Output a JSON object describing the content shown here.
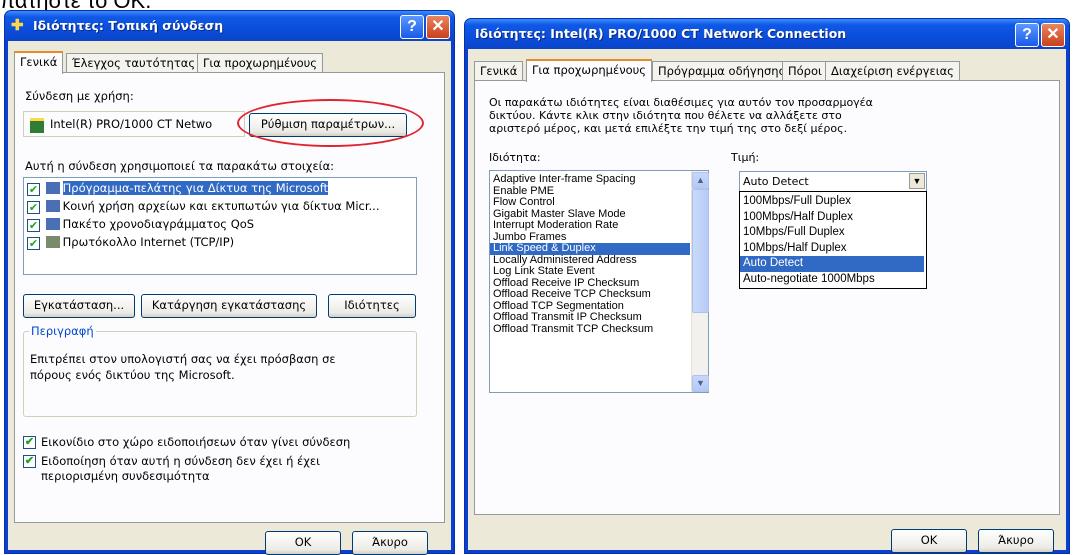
{
  "caption": "πατήστε το ΟΚ.",
  "win1": {
    "title": "Ιδιότητες: Τοπική σύνδεση",
    "tabs": [
      "Γενικά",
      "Έλεγχος ταυτότητας",
      "Για προχωρημένους"
    ],
    "connect_using_label": "Σύνδεση με χρήση:",
    "adapter_name": "Intel(R) PRO/1000 CT Netwo",
    "configure_button": "Ρύθμιση παραμέτρων...",
    "items_label": "Αυτή η σύνδεση χρησιμοποιεί τα παρακάτω στοιχεία:",
    "items": [
      "Πρόγραμμα-πελάτης για Δίκτυα της Microsoft",
      "Κοινή χρήση αρχείων και εκτυπωτών για δίκτυα Micr...",
      "Πακέτο χρονοδιαγράμματος QoS",
      "Πρωτόκολλο Internet (TCP/IP)"
    ],
    "install_button": "Εγκατάσταση...",
    "uninstall_button": "Κατάργηση εγκατάστασης",
    "properties_button": "Ιδιότητες",
    "description_title": "Περιγραφή",
    "description_text_1": "Επιτρέπει στον υπολογιστή σας να έχει πρόσβαση σε",
    "description_text_2": "πόρους ενός δικτύου της Microsoft.",
    "check_notify_icon": "Εικονίδιο στο χώρο ειδοποιήσεων όταν γίνει σύνδεση",
    "check_notify_limited_1": "Ειδοποίηση όταν αυτή η σύνδεση δεν έχει ή έχει",
    "check_notify_limited_2": "περιορισμένη συνδεσιμότητα",
    "ok_button": "OK",
    "cancel_button": "Άκυρο"
  },
  "win2": {
    "title": "Ιδιότητες: Intel(R) PRO/1000 CT Network Connection",
    "tabs": [
      "Γενικά",
      "Για προχωρημένους",
      "Πρόγραμμα οδήγησης",
      "Πόροι",
      "Διαχείριση ενέργειας"
    ],
    "intro_1": "Οι παρακάτω ιδιότητες είναι διαθέσιμες για αυτόν τον προσαρμογέα",
    "intro_2": "δικτύου. Κάντε κλικ στην ιδιότητα που θέλετε να αλλάξετε στο",
    "intro_3": "αριστερό μέρος, και μετά επιλέξτε την τιμή της στο δεξί μέρος.",
    "property_label": "Ιδιότητα:",
    "value_label": "Τιμή:",
    "properties": [
      "Adaptive Inter-frame Spacing",
      "Enable PME",
      "Flow Control",
      "Gigabit Master Slave Mode",
      "Interrupt Moderation Rate",
      "Jumbo Frames",
      "Link Speed & Duplex",
      "Locally Administered Address",
      "Log Link State Event",
      "Offload Receive IP Checksum",
      "Offload Receive TCP Checksum",
      "Offload TCP Segmentation",
      "Offload Transmit IP Checksum",
      "Offload Transmit TCP Checksum"
    ],
    "selected_property": "Link Speed & Duplex",
    "value_selected": "Auto Detect",
    "value_options": [
      "100Mbps/Full Duplex",
      "100Mbps/Half Duplex",
      "10Mbps/Full Duplex",
      "10Mbps/Half Duplex",
      "Auto Detect",
      "Auto-negotiate 1000Mbps"
    ],
    "ok_button": "OK",
    "cancel_button": "Άκυρο"
  },
  "colors": {
    "selection": "#316ac5",
    "highlight_oval": "#e0242f",
    "titlebar": "#0a4bd8"
  }
}
